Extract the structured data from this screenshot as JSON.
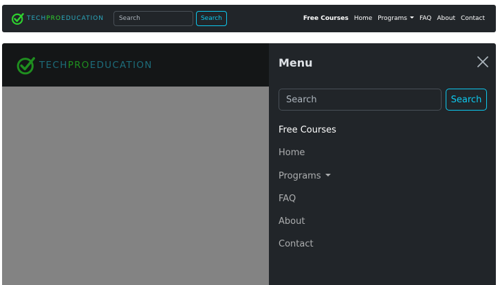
{
  "brand": {
    "part1": "TECH",
    "part2": "PRO",
    "part3": "EDUCATION"
  },
  "topbar": {
    "search_placeholder": "Search",
    "search_button": "Search",
    "links": [
      "Free Courses",
      "Home",
      "Programs",
      "FAQ",
      "About",
      "Contact"
    ]
  },
  "offcanvas": {
    "title": "Menu",
    "search_placeholder": "Search",
    "search_button": "Search",
    "links": [
      "Free Courses",
      "Home",
      "Programs",
      "FAQ",
      "About",
      "Contact"
    ]
  },
  "colors": {
    "navbar_bg": "#212529",
    "brand_blue": "#2aa8bd",
    "brand_green": "#2fd12f",
    "info_accent": "#0dcaf0",
    "backdrop": "#838383"
  },
  "icons": {
    "logo": "check-circle-logo-icon",
    "close": "close-icon",
    "dropdown": "caret-down-icon"
  }
}
